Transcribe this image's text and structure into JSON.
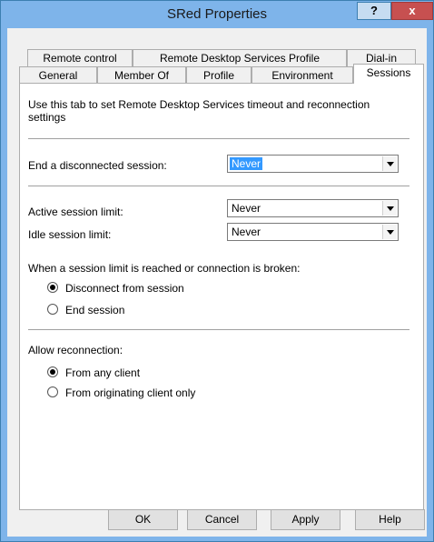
{
  "window": {
    "title": "SRed Properties",
    "help_label": "?",
    "close_label": "x"
  },
  "tabs": {
    "row_top": [
      "Remote control",
      "Remote Desktop Services Profile",
      "Dial-in"
    ],
    "row_bottom": [
      "General",
      "Member Of",
      "Profile",
      "Environment",
      "Sessions"
    ],
    "active": "Sessions"
  },
  "sessions": {
    "description": "Use this tab to set Remote Desktop Services timeout and reconnection settings",
    "end_disconnected": {
      "label": "End a disconnected session:",
      "value": "Never"
    },
    "active_limit": {
      "label": "Active session limit:",
      "value": "Never"
    },
    "idle_limit": {
      "label": "Idle session limit:",
      "value": "Never"
    },
    "limit_reached": {
      "label": "When a session limit is reached or connection is broken:",
      "options": [
        "Disconnect from session",
        "End session"
      ],
      "selected": "Disconnect from session"
    },
    "reconnection": {
      "label": "Allow reconnection:",
      "options": [
        "From any client",
        "From originating client only"
      ],
      "selected": "From any client"
    }
  },
  "buttons": {
    "ok": "OK",
    "cancel": "Cancel",
    "apply": "Apply",
    "help": "Help"
  }
}
